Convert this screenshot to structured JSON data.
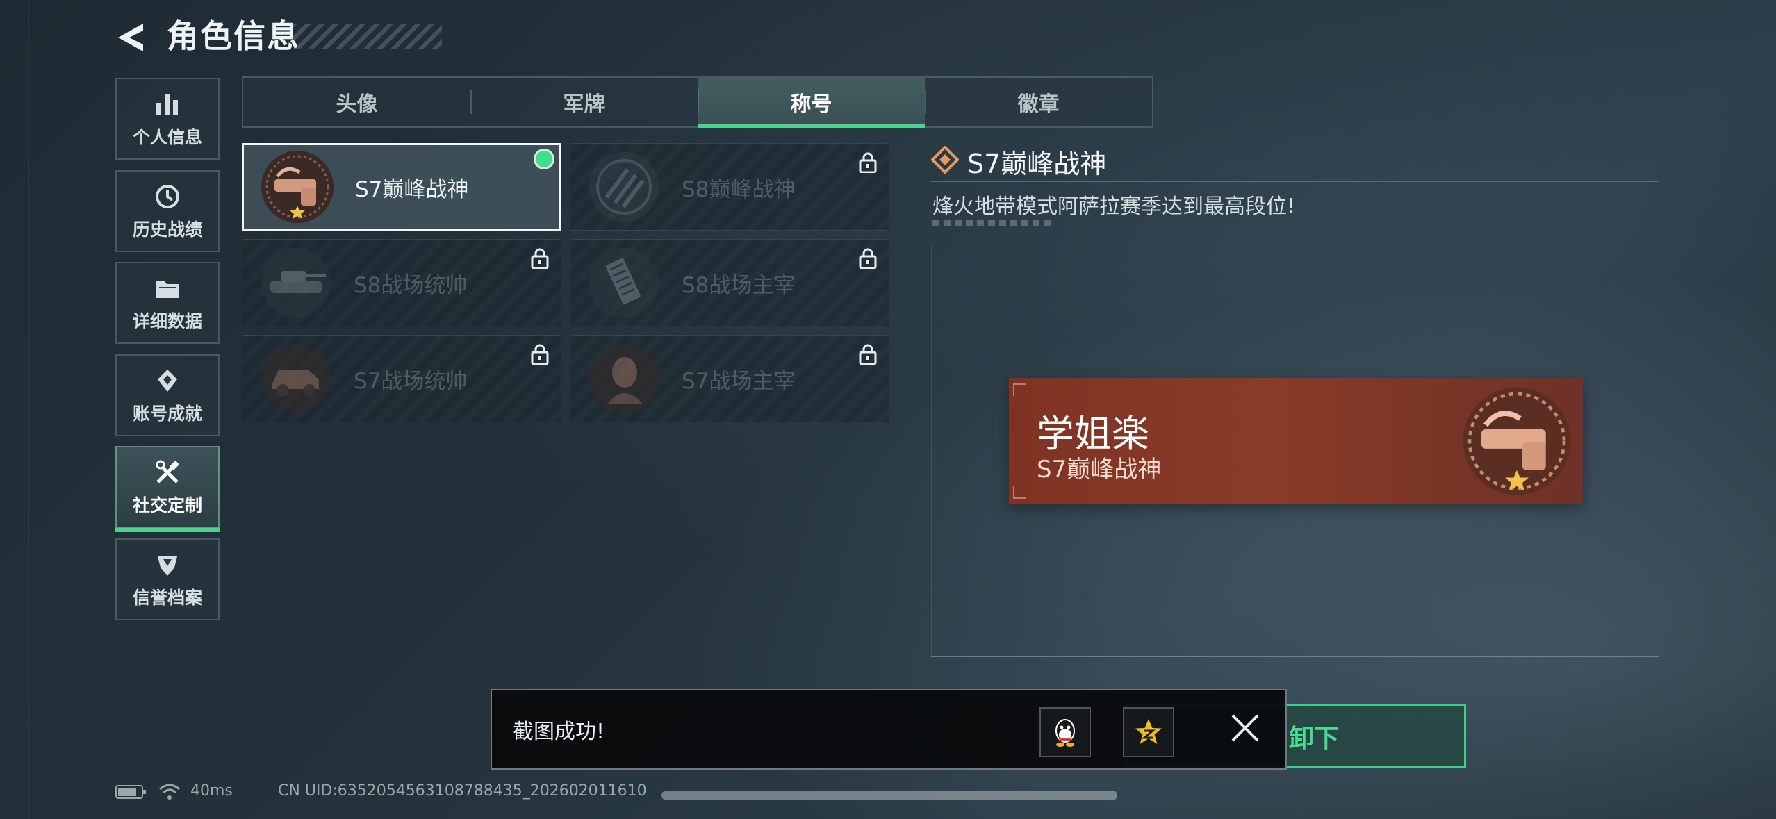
{
  "header": {
    "title": "角色信息"
  },
  "sidebar": {
    "items": [
      {
        "label": "个人信息",
        "icon": "bar-chart-icon"
      },
      {
        "label": "历史战绩",
        "icon": "history-clock-icon"
      },
      {
        "label": "详细数据",
        "icon": "folder-icon"
      },
      {
        "label": "账号成就",
        "icon": "achievement-icon"
      },
      {
        "label": "社交定制",
        "icon": "tools-icon",
        "active": true
      },
      {
        "label": "信誉档案",
        "icon": "shield-badge-icon"
      }
    ]
  },
  "tabs": [
    {
      "label": "头像"
    },
    {
      "label": "军牌"
    },
    {
      "label": "称号",
      "active": true
    },
    {
      "label": "徽章"
    }
  ],
  "titles": [
    {
      "name": "S7巅峰战神",
      "locked": false,
      "selected": true,
      "equipped": true
    },
    {
      "name": "S8巅峰战神",
      "locked": true
    },
    {
      "name": "S8战场统帅",
      "locked": true
    },
    {
      "name": "S8战场主宰",
      "locked": true
    },
    {
      "name": "S7战场统帅",
      "locked": true
    },
    {
      "name": "S7战场主宰",
      "locked": true
    }
  ],
  "detail": {
    "title": "S7巅峰战神",
    "description": "烽火地带模式阿萨拉赛季达到最高段位!"
  },
  "preview": {
    "player_name": "学姐楽",
    "title": "S7巅峰战神"
  },
  "unequip_button": {
    "label": "卸下"
  },
  "toast": {
    "message": "截图成功!"
  },
  "status": {
    "ping": "40ms",
    "uid": "CN UID:6352054563108788435_202602011610"
  },
  "colors": {
    "accent": "#4fd08e",
    "banner": "#8b3b28",
    "emblem": "#c98a70"
  }
}
